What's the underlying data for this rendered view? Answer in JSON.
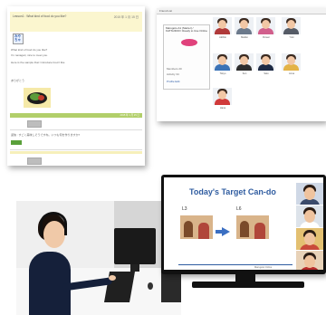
{
  "forum": {
    "question": "Lesson1 : What kind of food do you like?",
    "date": "2015 年 1 月 15 日",
    "avatar_text": "みや\nちゃ",
    "post_line1": "What kind of food do you like?",
    "post_line2": "I'm nanagari, nice to meet you.",
    "post_line3": "Here is the sample that I introduce food I like",
    "comment_label": "ありがとう",
    "green_bar_label": "2015 年 1 月 15 日",
    "reply_line": "返信 : すごく美味しそうですね。いつも何を作りますか?"
  },
  "profile": {
    "header": "Friend List",
    "card_title": "Marugoto A1 (Starter) / KATSUDOO: Ready to Use Online",
    "info_rows": [
      "Members 20",
      "Activity 34"
    ],
    "link": "Profile Edit",
    "people": [
      {
        "label": "Akihito",
        "color": "#b03a3a"
      },
      {
        "label": "Mariko",
        "color": "#6c7a8c"
      },
      {
        "label": "Flower",
        "color": "#d15f8c"
      },
      {
        "label": "Yuki",
        "color": "#555b66"
      },
      {
        "label": "Tokyo",
        "color": "#3a72b6"
      },
      {
        "label": "Ken",
        "color": "#2d2d2d"
      },
      {
        "label": "Sato",
        "color": "#1d2a44"
      },
      {
        "label": "Anna",
        "color": "#e3b347"
      },
      {
        "label": "Hana",
        "color": "#d03a3a"
      }
    ]
  },
  "slide": {
    "title": "Today's Target Can-do",
    "label_left": "L3",
    "label_right": "L6",
    "footer": "Marugoto Online"
  }
}
